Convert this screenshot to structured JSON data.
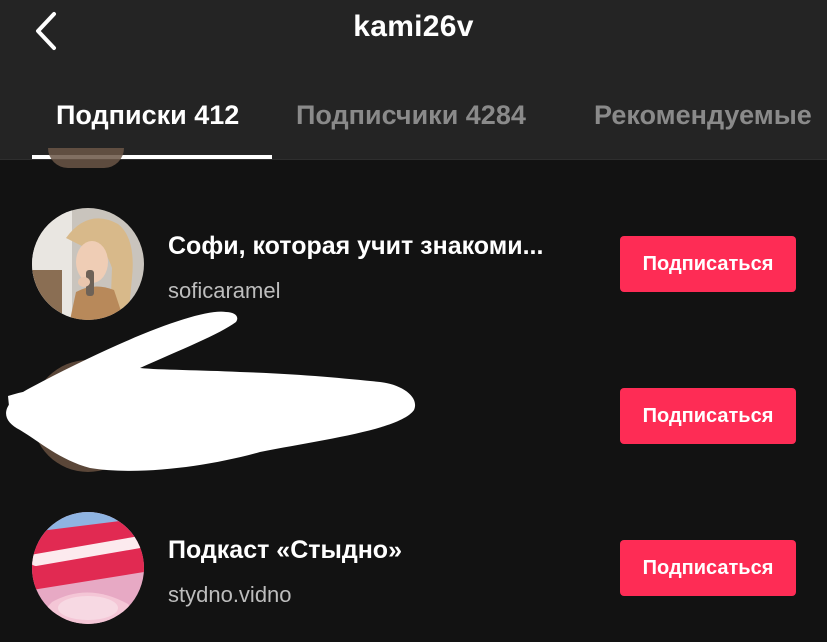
{
  "header": {
    "back_icon": "chevron-left-icon",
    "title": "kami26v"
  },
  "tabs": [
    {
      "label": "Подписки 412",
      "active": true
    },
    {
      "label": "Подписчики 4284",
      "active": false
    },
    {
      "label": "Рекомендуемые",
      "active": false
    }
  ],
  "accounts": [
    {
      "name": "Софи, которая учит знакоми...",
      "handle": "soficaramel",
      "button": "Подписаться"
    },
    {
      "name": "",
      "handle": "",
      "button": "Подписаться"
    },
    {
      "name": "Подкаст «Стыдно»",
      "handle": "stydno.vidno",
      "button": "Подписаться"
    }
  ],
  "colors": {
    "header_bg": "#242424",
    "list_bg": "#121212",
    "accent": "#fe2c55"
  }
}
